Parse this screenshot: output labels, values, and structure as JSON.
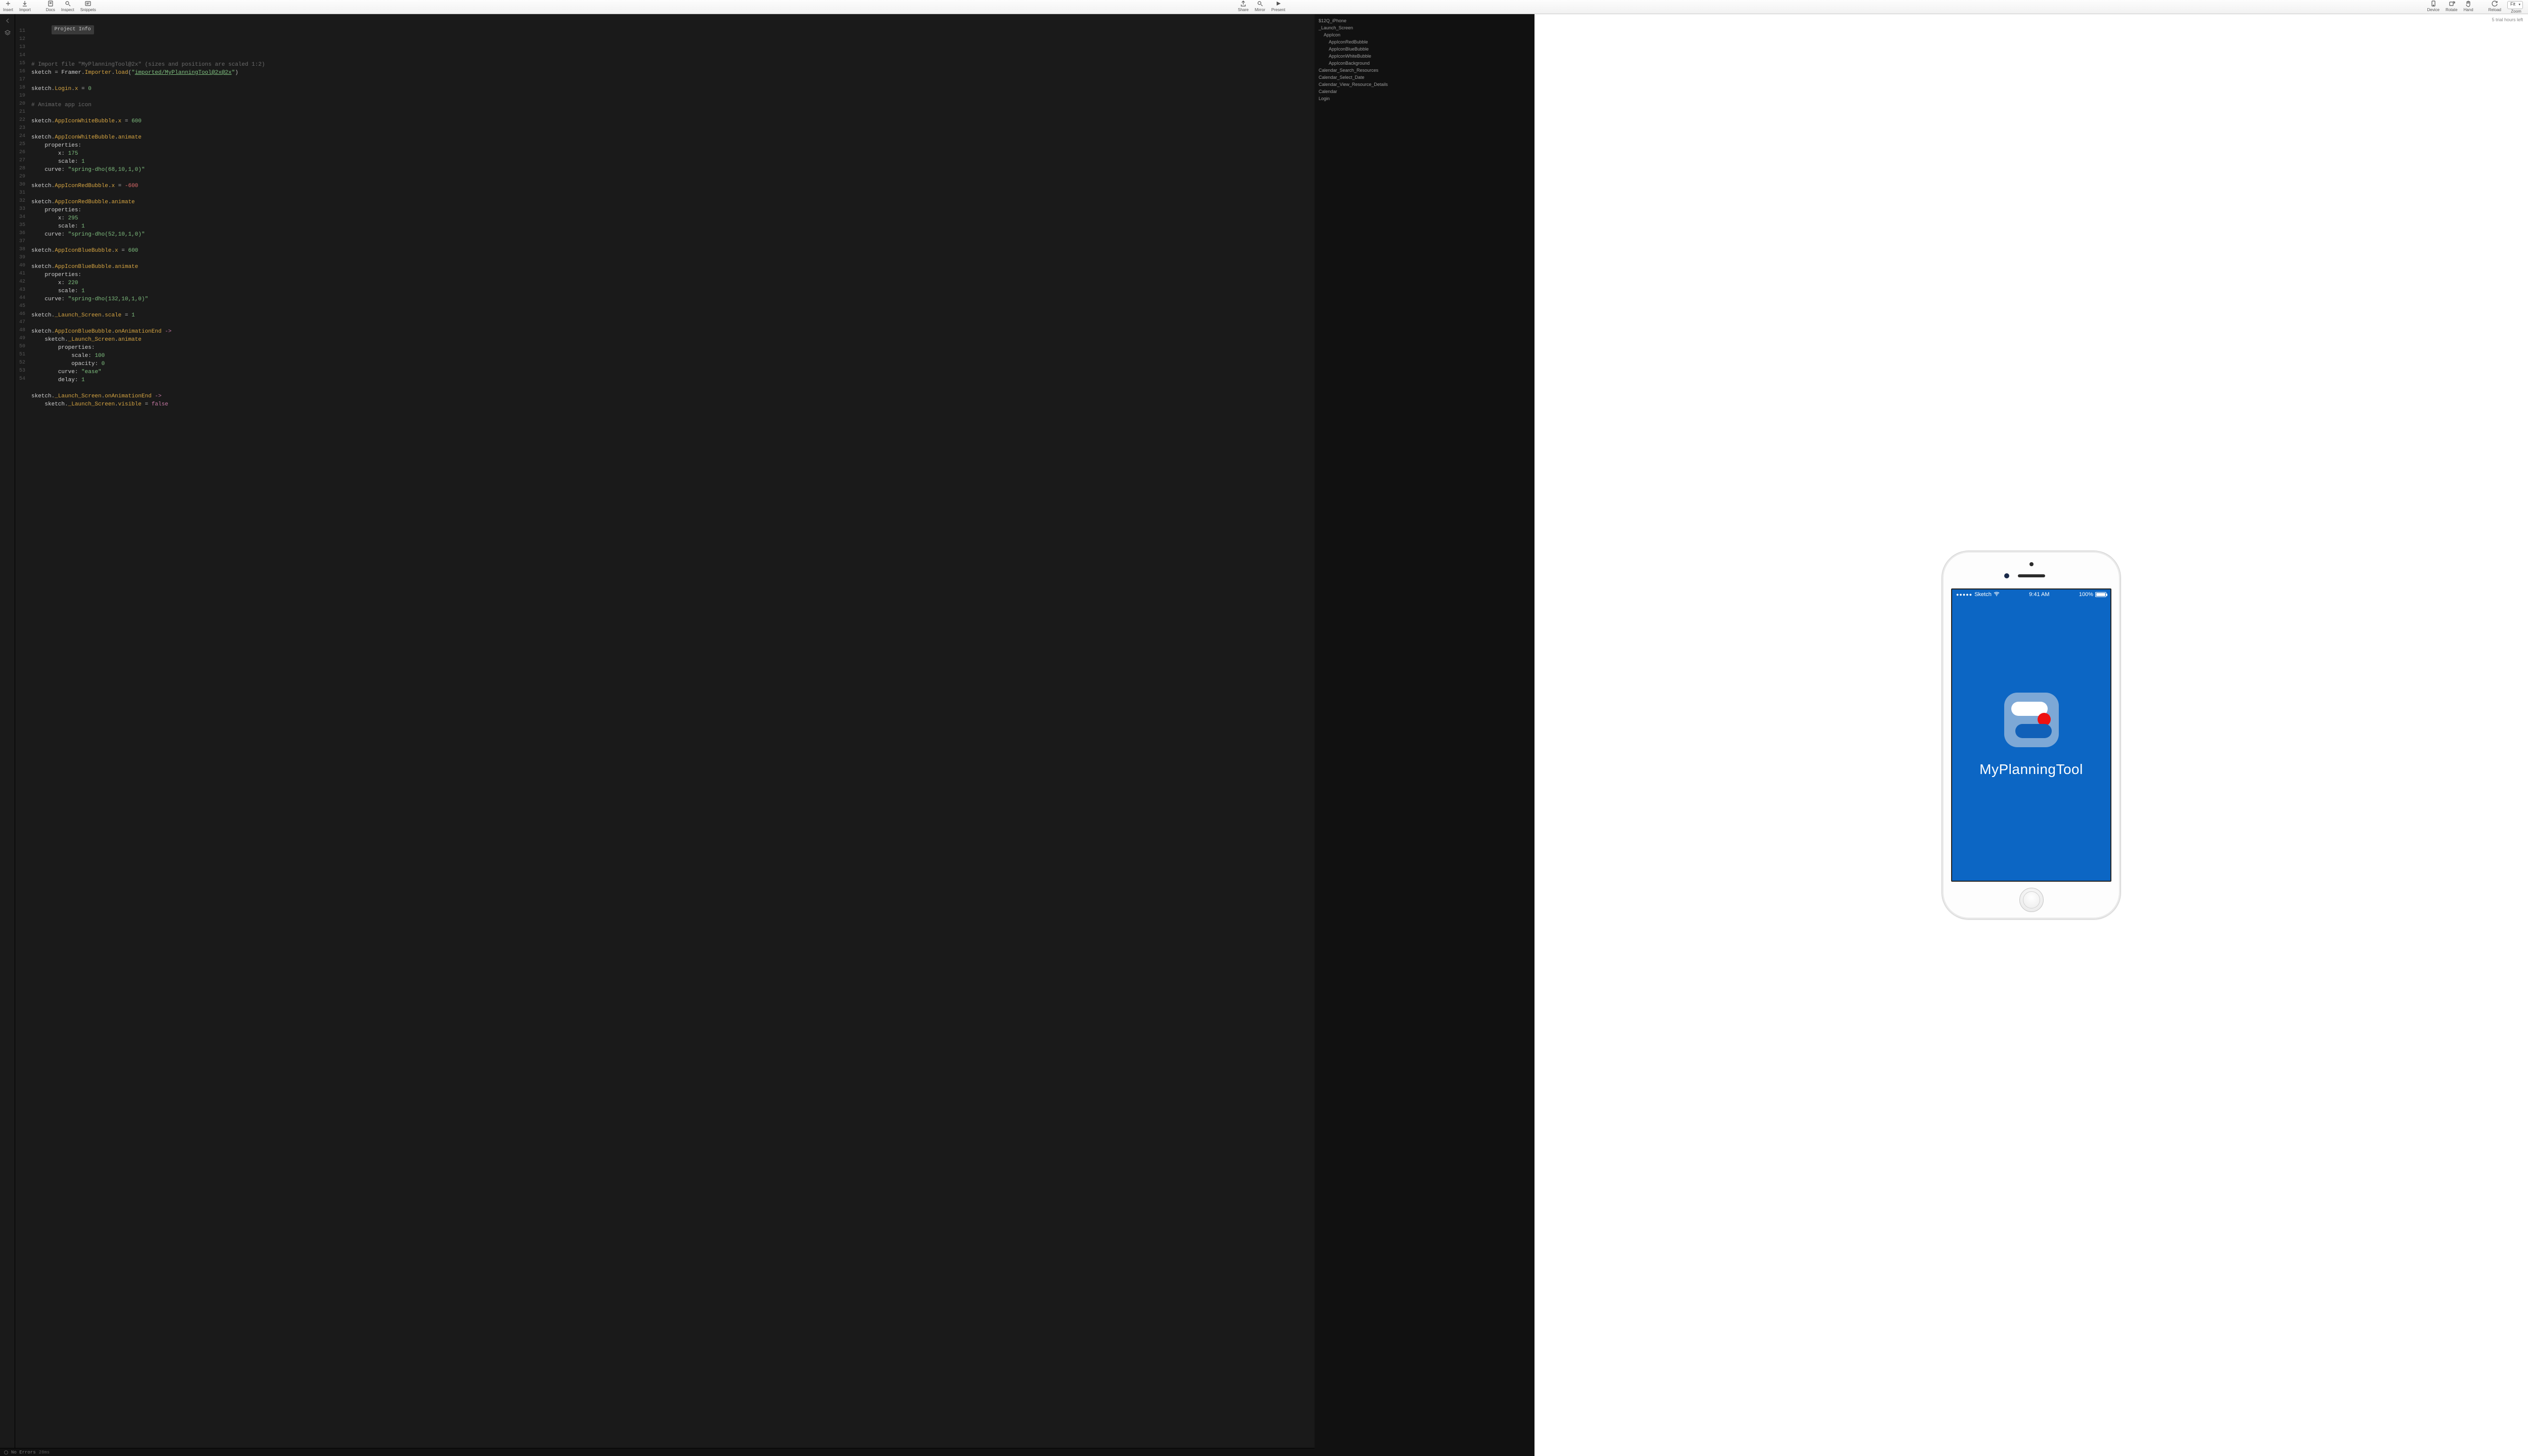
{
  "toolbar": {
    "left": [
      {
        "id": "insert",
        "label": "Insert"
      },
      {
        "id": "import",
        "label": "Import"
      }
    ],
    "left2": [
      {
        "id": "docs",
        "label": "Docs"
      },
      {
        "id": "inspect",
        "label": "Inspect"
      },
      {
        "id": "snippets",
        "label": "Snippets"
      }
    ],
    "center": [
      {
        "id": "share",
        "label": "Share"
      },
      {
        "id": "mirror",
        "label": "Mirror"
      },
      {
        "id": "present",
        "label": "Present"
      }
    ],
    "right": [
      {
        "id": "device",
        "label": "Device"
      },
      {
        "id": "rotate",
        "label": "Rotate"
      },
      {
        "id": "hand",
        "label": "Hand"
      }
    ],
    "right2": [
      {
        "id": "reload",
        "label": "Reload"
      }
    ],
    "zoom": {
      "label": "Zoom",
      "value": "Fit"
    }
  },
  "trial_text": "5 trial hours left",
  "project_info_chip": "Project Info",
  "code": {
    "lines": [
      {
        "n": 11,
        "t": "comment",
        "text": "# Import file \"MyPlanningTool@2x\" (sizes and positions are scaled 1:2)"
      },
      {
        "n": 12,
        "t": "import",
        "ident": "sketch",
        "eq": " = ",
        "mod": "Framer.",
        "cls": "Importer",
        "dot": ".",
        "m": "load",
        "open": "(\"",
        "link": "imported/MyPlanningTool@2x@2x",
        "close": "\")"
      },
      {
        "n": 13,
        "t": "blank"
      },
      {
        "n": 14,
        "t": "assign",
        "path": [
          "sketch",
          ".",
          "Login",
          ".",
          "x"
        ],
        "val": "0",
        "vt": "num"
      },
      {
        "n": 15,
        "t": "blank"
      },
      {
        "n": 16,
        "t": "comment",
        "text": "# Animate app icon"
      },
      {
        "n": 17,
        "t": "blank"
      },
      {
        "n": 18,
        "t": "assign",
        "path": [
          "sketch",
          ".",
          "AppIconWhiteBubble",
          ".",
          "x"
        ],
        "val": "600",
        "vt": "num"
      },
      {
        "n": 19,
        "t": "blank"
      },
      {
        "n": 20,
        "t": "call",
        "path": [
          "sketch",
          ".",
          "AppIconWhiteBubble",
          ".",
          "animate"
        ]
      },
      {
        "n": 21,
        "t": "kv",
        "ind": 1,
        "k": "properties",
        "v": "",
        "vt": "none",
        "tc": true
      },
      {
        "n": 22,
        "t": "kv",
        "ind": 2,
        "k": "x",
        "v": "175",
        "vt": "num"
      },
      {
        "n": 23,
        "t": "kv",
        "ind": 2,
        "k": "scale",
        "v": "1",
        "vt": "num"
      },
      {
        "n": 24,
        "t": "kv",
        "ind": 1,
        "k": "curve",
        "v": "\"spring-dho(68,10,1,0)\"",
        "vt": "str"
      },
      {
        "n": 25,
        "t": "blank"
      },
      {
        "n": 26,
        "t": "assign",
        "path": [
          "sketch",
          ".",
          "AppIconRedBubble",
          ".",
          "x"
        ],
        "val": "-600",
        "vt": "numneg"
      },
      {
        "n": 27,
        "t": "blank"
      },
      {
        "n": 28,
        "t": "call",
        "path": [
          "sketch",
          ".",
          "AppIconRedBubble",
          ".",
          "animate"
        ]
      },
      {
        "n": 29,
        "t": "kv",
        "ind": 1,
        "k": "properties",
        "v": "",
        "vt": "none",
        "tc": true
      },
      {
        "n": 30,
        "t": "kv",
        "ind": 2,
        "k": "x",
        "v": "295",
        "vt": "num"
      },
      {
        "n": 31,
        "t": "kv",
        "ind": 2,
        "k": "scale",
        "v": "1",
        "vt": "num"
      },
      {
        "n": 32,
        "t": "kv",
        "ind": 1,
        "k": "curve",
        "v": "\"spring-dho(52,10,1,0)\"",
        "vt": "str"
      },
      {
        "n": 33,
        "t": "blank"
      },
      {
        "n": 34,
        "t": "assign",
        "path": [
          "sketch",
          ".",
          "AppIconBlueBubble",
          ".",
          "x"
        ],
        "val": "600",
        "vt": "num"
      },
      {
        "n": 35,
        "t": "blank"
      },
      {
        "n": 36,
        "t": "call",
        "path": [
          "sketch",
          ".",
          "AppIconBlueBubble",
          ".",
          "animate"
        ]
      },
      {
        "n": 37,
        "t": "kv",
        "ind": 1,
        "k": "properties",
        "v": "",
        "vt": "none",
        "tc": true
      },
      {
        "n": 38,
        "t": "kv",
        "ind": 2,
        "k": "x",
        "v": "220",
        "vt": "num"
      },
      {
        "n": 39,
        "t": "kv",
        "ind": 2,
        "k": "scale",
        "v": "1",
        "vt": "num"
      },
      {
        "n": 40,
        "t": "kv",
        "ind": 1,
        "k": "curve",
        "v": "\"spring-dho(132,10,1,0)\"",
        "vt": "str"
      },
      {
        "n": 41,
        "t": "blank"
      },
      {
        "n": 42,
        "t": "assign",
        "path": [
          "sketch",
          ".",
          "_Launch_Screen",
          ".",
          "scale"
        ],
        "val": "1",
        "vt": "num"
      },
      {
        "n": 43,
        "t": "blank"
      },
      {
        "n": 44,
        "t": "event",
        "path": [
          "sketch",
          ".",
          "AppIconBlueBubble",
          ".",
          "onAnimationEnd"
        ],
        "arrow": " ->"
      },
      {
        "n": 45,
        "t": "call",
        "ind": 1,
        "path": [
          "sketch",
          ".",
          "_Launch_Screen",
          ".",
          "animate"
        ]
      },
      {
        "n": 46,
        "t": "kv",
        "ind": 2,
        "k": "properties",
        "v": "",
        "vt": "none",
        "tc": true
      },
      {
        "n": 47,
        "t": "kv",
        "ind": 3,
        "k": "scale",
        "v": "100",
        "vt": "num"
      },
      {
        "n": 48,
        "t": "kv",
        "ind": 3,
        "k": "opacity",
        "v": "0",
        "vt": "num"
      },
      {
        "n": 49,
        "t": "kv",
        "ind": 2,
        "k": "curve",
        "v": "\"ease\"",
        "vt": "str"
      },
      {
        "n": 50,
        "t": "kv",
        "ind": 2,
        "k": "delay",
        "v": "1",
        "vt": "num"
      },
      {
        "n": 51,
        "t": "blank"
      },
      {
        "n": 52,
        "t": "event",
        "path": [
          "sketch",
          ".",
          "_Launch_Screen",
          ".",
          "onAnimationEnd"
        ],
        "arrow": " ->"
      },
      {
        "n": 53,
        "t": "assign",
        "ind": 1,
        "path": [
          "sketch",
          ".",
          "_Launch_Screen",
          ".",
          "visible"
        ],
        "val": "false",
        "vt": "bool"
      },
      {
        "n": 54,
        "t": "blank"
      }
    ]
  },
  "statusbar": {
    "errors": "No Errors",
    "time": "28ms"
  },
  "layers": [
    {
      "l": "$12Q_iPhone",
      "ind": 0
    },
    {
      "l": "_Launch_Screen",
      "ind": 0
    },
    {
      "l": "AppIcon",
      "ind": 1
    },
    {
      "l": "AppIconRedBubble",
      "ind": 2
    },
    {
      "l": "AppIconBlueBubble",
      "ind": 2
    },
    {
      "l": "AppIconWhiteBubble",
      "ind": 2
    },
    {
      "l": "AppIconBackground",
      "ind": 2
    },
    {
      "l": "Calendar_Search_Resources",
      "ind": 0
    },
    {
      "l": "Calendar_Select_Date",
      "ind": 0
    },
    {
      "l": "Calendar_View_Resource_Details",
      "ind": 0
    },
    {
      "l": "Calendar",
      "ind": 0
    },
    {
      "l": "Login",
      "ind": 0
    }
  ],
  "device_status": {
    "carrier": "Sketch",
    "time": "9:41 AM",
    "battery": "100%"
  },
  "app_title": "MyPlanningTool"
}
